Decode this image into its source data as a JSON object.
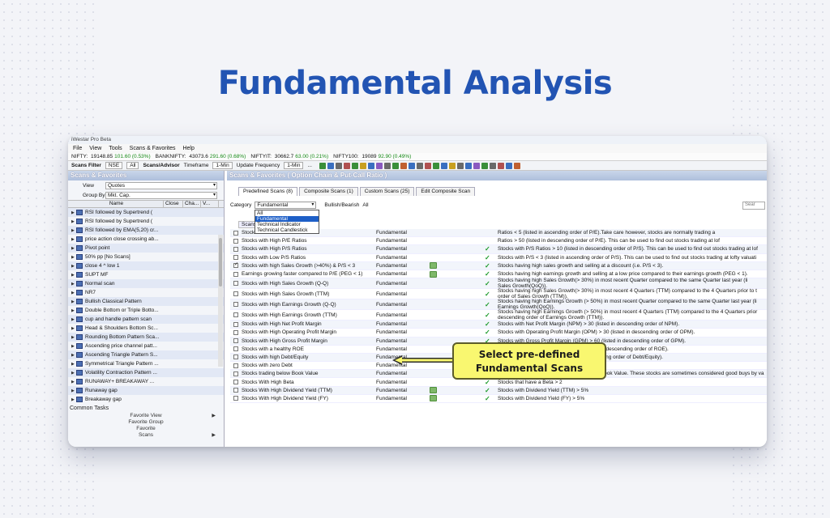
{
  "heading": "Fundamental Analysis",
  "callout": {
    "line1": "Select pre-defined",
    "line2": "Fundamental Scans"
  },
  "app": {
    "title": "iWestar Pro Beta",
    "menu": [
      "File",
      "View",
      "Tools",
      "Scans & Favorites",
      "Help"
    ],
    "tickers": [
      {
        "name": "NIFTY",
        "value": "19148.85",
        "change": "101.60 (0.53%)"
      },
      {
        "name": "BANKNIFTY",
        "value": "43073.6",
        "change": "291.60 (0.68%)"
      },
      {
        "name": "NIFTYIT",
        "value": "30662.7",
        "change": "63.00 (0.21%)"
      },
      {
        "name": "NIFTY100",
        "value": "19089",
        "change": "92.90 (0.49%)"
      }
    ],
    "toolbar": {
      "scans_filter": "Scans Filter",
      "exchange": "NSE",
      "segment": "All",
      "mode": "Scans/Advisor",
      "timeframe_label": "Timeframe",
      "timeframe": "1-Min",
      "update_label": "Update Frequency",
      "update": "1-Min",
      "more": "..."
    }
  },
  "left_panel": {
    "title": "Scans & Favorites",
    "view_label": "View",
    "view_value": "Quotes",
    "group_label": "Group By",
    "group_value": "Mkt. Cap.",
    "columns": [
      "Name",
      "Close",
      "Cha...",
      "V..."
    ],
    "items": [
      "RSI followed by Supertrend (",
      "RSI followed by Supertrend (",
      "RSI followed by EMA(5,20) cr...",
      "price action close crossing ab...",
      "Pivot point",
      "50% pp [No Scans]",
      "close 4 ^ low 1",
      "SUPT MF",
      "Normal scan",
      "NR7",
      "Bullish Classical Pattern",
      "Double Bottom or Triple Botto...",
      "cup and handle pattern scan",
      "Head & Shoulders Bottom Sc...",
      "Rounding Bottom Pattern Sca...",
      "Ascending price channel patt...",
      "Ascending Triangle Pattern S...",
      "Symmetrical Triangle Pattern ...",
      "Volatility Contraction Pattern ...",
      "RUNAWAY+ BREAKAWAY ...",
      "Runaway gap",
      "Breakaway gap"
    ],
    "common_tasks": "Common Tasks",
    "tasks": [
      "Favorite View",
      "Favorite Group",
      "Favorite",
      "Scans"
    ]
  },
  "right_panel": {
    "title": "Scans & Favorites ( Option Chain & Put-Call Ratio )",
    "tabs": [
      "Predefined Scans (8)",
      "Composite Scans (1)",
      "Custom Scans (25)",
      "Edit Composite Scan"
    ],
    "category_label": "Category",
    "category_value": "Fundamental",
    "bullish_label": "Bullish/Bearish",
    "bullish_value": "All",
    "search_placeholder": "Sear",
    "dropdown_options": [
      "All",
      "Fundamental",
      "Technical Indicator",
      "Technical Candlestick"
    ],
    "header_frag": "Scans",
    "rows": [
      {
        "name": "Stocks",
        "cat": "Fundamental",
        "icon": false,
        "check": false,
        "on": false,
        "desc": "Ratios < 5 (listed in ascending order of P/E).Take care however, stocks are normally trading a"
      },
      {
        "name": "Stocks with High P/E Ratios",
        "cat": "Fundamental",
        "icon": false,
        "check": false,
        "on": false,
        "desc": "Ratios > 50 (listed in descending order of P/E). This can be used to find out stocks trading at lof"
      },
      {
        "name": "Stocks with High P/S Ratios",
        "cat": "Fundamental",
        "icon": false,
        "check": true,
        "on": false,
        "desc": "Stocks with P/S Ratios > 10 (listed in descending order of P/S). This can be used to find out stocks trading at lof"
      },
      {
        "name": "Stocks with Low P/S Ratios",
        "cat": "Fundamental",
        "icon": false,
        "check": true,
        "on": false,
        "desc": "Stocks with P/S < 3 (listed in ascending order of P/S). This can be used to find out stocks trading at lofty valuati"
      },
      {
        "name": "Stocks with high Sales Growth (>40%) & P/S < 3",
        "cat": "Fundamental",
        "icon": true,
        "check": true,
        "on": true,
        "desc": "Stocks having high sales growth and selling at a discount (i.e. P/S < 3)."
      },
      {
        "name": "Earnings growing faster compared to P/E (PEG < 1)",
        "cat": "Fundamental",
        "icon": true,
        "check": true,
        "on": false,
        "desc": "Stocks having high earnings growth and selling at a low price compared to their earnings growth (PEG < 1)."
      },
      {
        "name": "Stocks with High Sales Growth (Q-Q)",
        "cat": "Fundamental",
        "icon": false,
        "check": true,
        "on": false,
        "desc": "Stocks having high Sales Growth(> 30%) in most recent Quarter compared to the same Quarter last year (li",
        "desc2": "Sales Growth(QoQ))."
      },
      {
        "name": "Stocks with High Sales Growth (TTM)",
        "cat": "Fundamental",
        "icon": false,
        "check": true,
        "on": false,
        "desc": "Stocks having high Sales Growth(> 30%) in most recent 4 Quarters (TTM) compared to the 4 Quarters prior to t",
        "desc2": "order of Sales Growth (TTM))."
      },
      {
        "name": "Stocks with High Earnings Growth (Q-Q)",
        "cat": "Fundamental",
        "icon": false,
        "check": true,
        "on": false,
        "desc": "Stocks having high Earnings Growth (> 50%) in most recent Quarter compared to the same Quarter last year (li",
        "desc2": "Earnings Growth(QoQ))."
      },
      {
        "name": "Stocks with High Earnings Growth (TTM)",
        "cat": "Fundamental",
        "icon": false,
        "check": true,
        "on": false,
        "desc": "Stocks having high Earnings Growth (> 50%) in most recent 4 Quarters (TTM) compared to the 4 Quarters prior",
        "desc2": "descending order of Earnings Growth (TTM))."
      },
      {
        "name": "Stocks with High Net Profit Margin",
        "cat": "Fundamental",
        "icon": false,
        "check": true,
        "on": false,
        "desc": "Stocks with Net Profit Margin (NPM) > 30 (listed in descending order of NPM)."
      },
      {
        "name": "Stocks with High Operating Profit Margin",
        "cat": "Fundamental",
        "icon": false,
        "check": true,
        "on": false,
        "desc": "Stocks with Operating Profit Margin (OPM) > 30 (listed in descending order of OPM)."
      },
      {
        "name": "Stocks with High Gross Profit Margin",
        "cat": "Fundamental",
        "icon": false,
        "check": true,
        "on": false,
        "desc": "Stocks with Gross Profit Margin (GPM) > 60 (listed in descending order of GPM)."
      },
      {
        "name": "Stocks with a healthy ROE",
        "cat": "Fundamental",
        "icon": false,
        "check": true,
        "on": false,
        "desc": "Stocks with Return-On-Equity > 30% (listed in descending order of ROE)."
      },
      {
        "name": "Stocks with high Debt/Equity",
        "cat": "Fundamental",
        "icon": false,
        "check": true,
        "on": false,
        "desc": "Stocks with Debt/Equity > 4 (listed in descending order of Debt/Equity)."
      },
      {
        "name": "Stocks with zero Debt",
        "cat": "Fundamental",
        "icon": false,
        "check": true,
        "on": false,
        "desc": "Stocks with Debt/Equity = 0."
      },
      {
        "name": "Stocks trading below Book Value",
        "cat": "Fundamental",
        "icon": false,
        "check": true,
        "on": false,
        "desc": "Stocks with Market Capitalization below the Book Value. These stocks are sometimes considered good buys by va"
      },
      {
        "name": "Stocks With High Beta",
        "cat": "Fundamental",
        "icon": false,
        "check": true,
        "on": false,
        "desc": "Stocks that have a Beta > 2"
      },
      {
        "name": "Stocks With High Dividend Yield (TTM)",
        "cat": "Fundamental",
        "icon": true,
        "check": true,
        "on": false,
        "desc": "Stocks with Dividend Yield (TTM) > 5%"
      },
      {
        "name": "Stocks With High Dividend Yield (FY)",
        "cat": "Fundamental",
        "icon": true,
        "check": true,
        "on": false,
        "desc": "Stocks with Dividend Yield (FY) > 5%"
      }
    ]
  },
  "colors": {
    "heading": "#2254b3",
    "callout": "#f9f770",
    "check": "#1c9a2a",
    "selection": "#1e5fc7"
  }
}
